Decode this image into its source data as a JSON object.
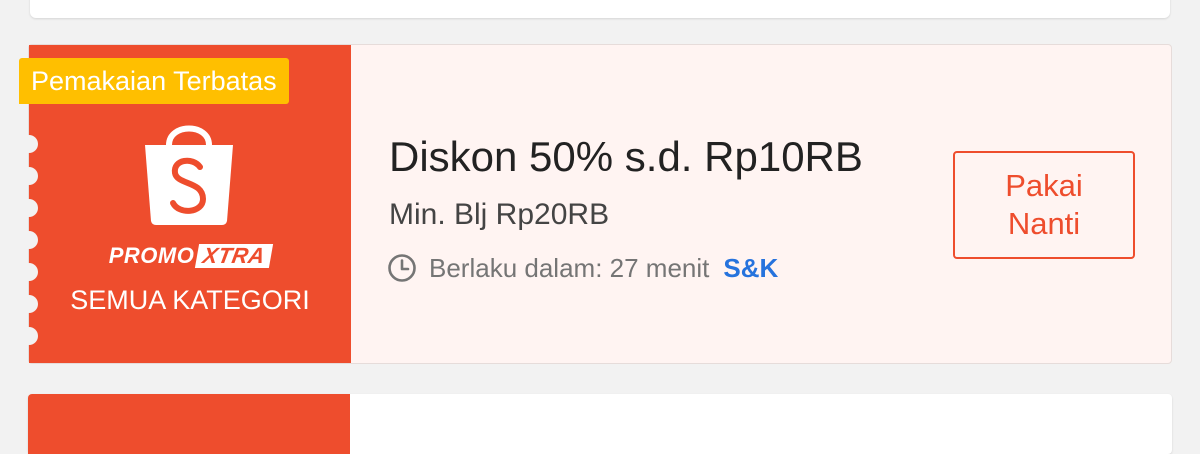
{
  "voucher": {
    "badge": "Pemakaian Terbatas",
    "brand_promo": "PROMO",
    "brand_xtra": "XTRA",
    "category": "SEMUA KATEGORI",
    "title": "Diskon 50% s.d. Rp10RB",
    "min_spend": "Min. Blj Rp20RB",
    "validity": "Berlaku dalam: 27 menit",
    "terms_link": "S&K",
    "action_button": "Pakai Nanti",
    "icons": {
      "brand": "shopping-bag-icon",
      "validity": "clock-icon"
    }
  },
  "colors": {
    "brand": "#ee4d2d",
    "badge": "#ffbf00",
    "link": "#2673dd",
    "card_background": "#fff4f2",
    "page_background": "#f2f2f2"
  }
}
